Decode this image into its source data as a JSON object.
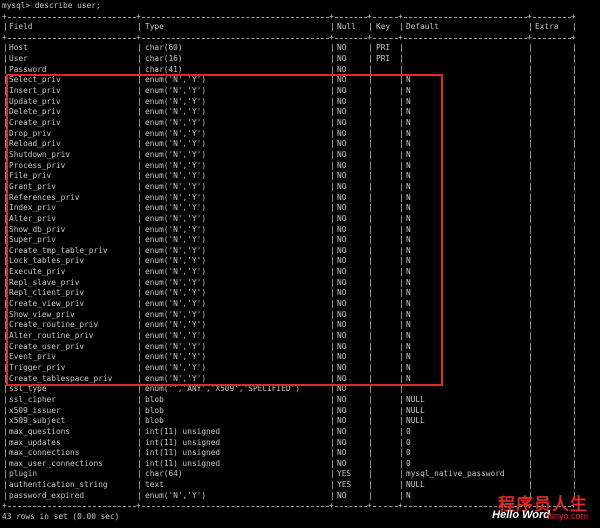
{
  "terminal": {
    "command": "mysql> describe user;",
    "footer": "43 rows in set (0.00 sec)"
  },
  "table": {
    "headers": [
      "Field",
      "Type",
      "Null",
      "Key",
      "Default",
      "Extra"
    ],
    "rows": [
      [
        "Host",
        "char(60)",
        "NO",
        "PRI",
        "",
        ""
      ],
      [
        "User",
        "char(16)",
        "NO",
        "PRI",
        "",
        ""
      ],
      [
        "Password",
        "char(41)",
        "NO",
        "",
        "",
        ""
      ],
      [
        "Select_priv",
        "enum('N','Y')",
        "NO",
        "",
        "N",
        ""
      ],
      [
        "Insert_priv",
        "enum('N','Y')",
        "NO",
        "",
        "N",
        ""
      ],
      [
        "Update_priv",
        "enum('N','Y')",
        "NO",
        "",
        "N",
        ""
      ],
      [
        "Delete_priv",
        "enum('N','Y')",
        "NO",
        "",
        "N",
        ""
      ],
      [
        "Create_priv",
        "enum('N','Y')",
        "NO",
        "",
        "N",
        ""
      ],
      [
        "Drop_priv",
        "enum('N','Y')",
        "NO",
        "",
        "N",
        ""
      ],
      [
        "Reload_priv",
        "enum('N','Y')",
        "NO",
        "",
        "N",
        ""
      ],
      [
        "Shutdown_priv",
        "enum('N','Y')",
        "NO",
        "",
        "N",
        ""
      ],
      [
        "Process_priv",
        "enum('N','Y')",
        "NO",
        "",
        "N",
        ""
      ],
      [
        "File_priv",
        "enum('N','Y')",
        "NO",
        "",
        "N",
        ""
      ],
      [
        "Grant_priv",
        "enum('N','Y')",
        "NO",
        "",
        "N",
        ""
      ],
      [
        "References_priv",
        "enum('N','Y')",
        "NO",
        "",
        "N",
        ""
      ],
      [
        "Index_priv",
        "enum('N','Y')",
        "NO",
        "",
        "N",
        ""
      ],
      [
        "Alter_priv",
        "enum('N','Y')",
        "NO",
        "",
        "N",
        ""
      ],
      [
        "Show_db_priv",
        "enum('N','Y')",
        "NO",
        "",
        "N",
        ""
      ],
      [
        "Super_priv",
        "enum('N','Y')",
        "NO",
        "",
        "N",
        ""
      ],
      [
        "Create_tmp_table_priv",
        "enum('N','Y')",
        "NO",
        "",
        "N",
        ""
      ],
      [
        "Lock_tables_priv",
        "enum('N','Y')",
        "NO",
        "",
        "N",
        ""
      ],
      [
        "Execute_priv",
        "enum('N','Y')",
        "NO",
        "",
        "N",
        ""
      ],
      [
        "Repl_slave_priv",
        "enum('N','Y')",
        "NO",
        "",
        "N",
        ""
      ],
      [
        "Repl_client_priv",
        "enum('N','Y')",
        "NO",
        "",
        "N",
        ""
      ],
      [
        "Create_view_priv",
        "enum('N','Y')",
        "NO",
        "",
        "N",
        ""
      ],
      [
        "Show_view_priv",
        "enum('N','Y')",
        "NO",
        "",
        "N",
        ""
      ],
      [
        "Create_routine_priv",
        "enum('N','Y')",
        "NO",
        "",
        "N",
        ""
      ],
      [
        "Alter_routine_priv",
        "enum('N','Y')",
        "NO",
        "",
        "N",
        ""
      ],
      [
        "Create_user_priv",
        "enum('N','Y')",
        "NO",
        "",
        "N",
        ""
      ],
      [
        "Event_priv",
        "enum('N','Y')",
        "NO",
        "",
        "N",
        ""
      ],
      [
        "Trigger_priv",
        "enum('N','Y')",
        "NO",
        "",
        "N",
        ""
      ],
      [
        "Create_tablespace_priv",
        "enum('N','Y')",
        "NO",
        "",
        "N",
        ""
      ],
      [
        "ssl_type",
        "enum('','ANY','X509','SPECIFIED')",
        "NO",
        "",
        "",
        ""
      ],
      [
        "ssl_cipher",
        "blob",
        "NO",
        "",
        "NULL",
        ""
      ],
      [
        "x509_issuer",
        "blob",
        "NO",
        "",
        "NULL",
        ""
      ],
      [
        "x509_subject",
        "blob",
        "NO",
        "",
        "NULL",
        ""
      ],
      [
        "max_questions",
        "int(11) unsigned",
        "NO",
        "",
        "0",
        ""
      ],
      [
        "max_updates",
        "int(11) unsigned",
        "NO",
        "",
        "0",
        ""
      ],
      [
        "max_connections",
        "int(11) unsigned",
        "NO",
        "",
        "0",
        ""
      ],
      [
        "max_user_connections",
        "int(11) unsigned",
        "NO",
        "",
        "0",
        ""
      ],
      [
        "plugin",
        "char(64)",
        "YES",
        "",
        "mysql_native_password",
        ""
      ],
      [
        "authentication_string",
        "text",
        "YES",
        "",
        "NULL",
        ""
      ],
      [
        "password_expired",
        "enum('N','Y')",
        "NO",
        "",
        "N",
        ""
      ]
    ]
  },
  "highlight": {
    "color": "#e02a2a",
    "from_field": "Select_priv",
    "to_field": "Create_tablespace_priv"
  },
  "watermark": {
    "chinese": "程序员人生",
    "english": "Hello Word",
    "site": "itinyo.com"
  },
  "colors": {
    "background": "#000000",
    "text": "#c8c8c8",
    "accent": "#e02a2a"
  }
}
